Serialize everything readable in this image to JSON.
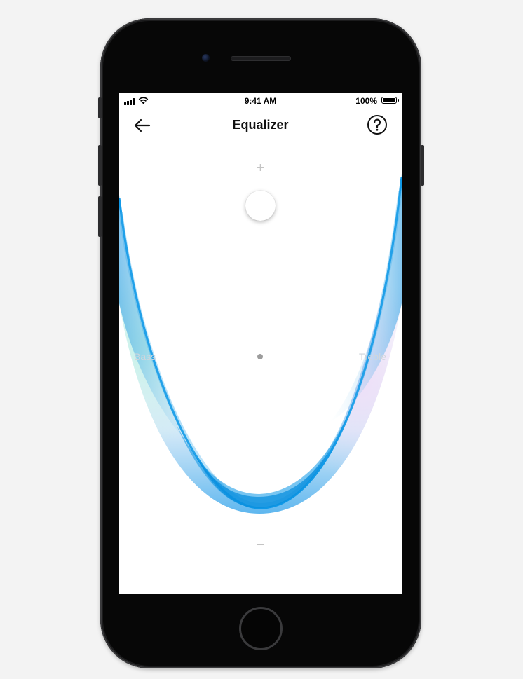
{
  "status_bar": {
    "time": "9:41 AM",
    "battery_percent": "100%",
    "signal_icon": "cellular-signal-icon",
    "wifi_icon": "wifi-icon",
    "battery_icon": "battery-full-icon"
  },
  "nav": {
    "title": "Equalizer",
    "back_icon": "arrow-left-icon",
    "help_icon": "question-circle-icon"
  },
  "equalizer": {
    "increase_label": "+",
    "decrease_label": "−",
    "bass_label": "Bass",
    "treble_label": "Treble",
    "curve_colors": {
      "primary": "#0a96e6",
      "accent_left": "#9ee6d8",
      "accent_right": "#e9d6f4"
    }
  }
}
